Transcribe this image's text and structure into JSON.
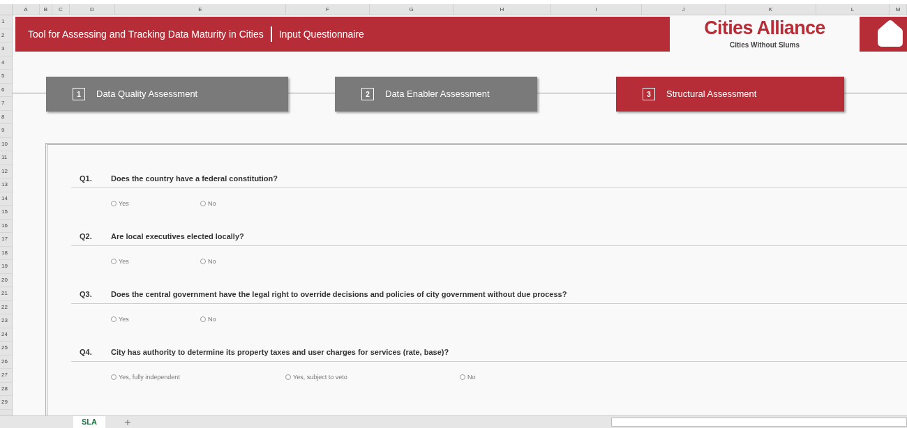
{
  "columns": [
    "A",
    "B",
    "C",
    "D",
    "E",
    "F",
    "G",
    "H",
    "I",
    "J",
    "K",
    "L",
    "M"
  ],
  "rows": [
    "1",
    "2",
    "3",
    "4",
    "5",
    "6",
    "7",
    "8",
    "9",
    "10",
    "11",
    "12",
    "13",
    "14",
    "15",
    "16",
    "17",
    "18",
    "19",
    "20",
    "21",
    "22",
    "23",
    "24",
    "25",
    "26",
    "27",
    "28",
    "29"
  ],
  "banner": {
    "title": "Tool for Assessing and Tracking Data Maturity in Cities",
    "subtitle": "Input Questionnaire"
  },
  "logo": {
    "name": "Cities Alliance",
    "tagline": "Cities Without Slums"
  },
  "steps": [
    {
      "number": "1",
      "label": "Data Quality Assessment",
      "selected": false
    },
    {
      "number": "2",
      "label": "Data Enabler Assessment",
      "selected": false
    },
    {
      "number": "3",
      "label": "Structural Assessment",
      "selected": true
    }
  ],
  "questions": [
    {
      "number": "Q1.",
      "text": "Does the country have a federal constitution?",
      "options": [
        {
          "label": "Yes",
          "selected": false
        },
        {
          "label": "No",
          "selected": false
        }
      ]
    },
    {
      "number": "Q2.",
      "text": "Are local executives elected locally?",
      "options": [
        {
          "label": "Yes",
          "selected": false
        },
        {
          "label": "No",
          "selected": false
        }
      ]
    },
    {
      "number": "Q3.",
      "text": "Does the central government have the legal right to override decisions and policies of city government without due process?",
      "options": [
        {
          "label": "Yes",
          "selected": false
        },
        {
          "label": "No",
          "selected": false
        }
      ]
    },
    {
      "number": "Q4.",
      "text": "City has authority to determine its property taxes and user charges for services (rate, base)?",
      "options": [
        {
          "label": "Yes, fully independent",
          "selected": false
        },
        {
          "label": "Yes, subject to veto",
          "selected": false
        },
        {
          "label": "No",
          "selected": false
        }
      ]
    }
  ],
  "sheet_tabs": [
    {
      "label": "SLA",
      "selected": true
    }
  ]
}
